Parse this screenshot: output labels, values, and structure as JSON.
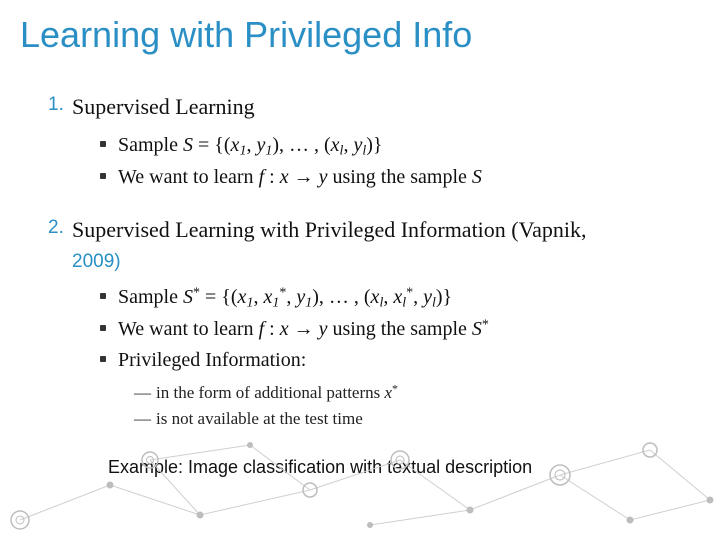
{
  "title": "Learning with Privileged Info",
  "sections": [
    {
      "num": "1.",
      "heading": "Supervised Learning",
      "bullets": [
        {
          "html": "Sample <span class='mi'>S</span> = {(<span class='mi'>x</span><span class='sub'>1</span>, <span class='mi'>y</span><span class='sub'>1</span>), … , (<span class='mi'>x</span><span class='sub'>l</span>, <span class='mi'>y</span><span class='sub'>l</span>)}"
        },
        {
          "html": "We want to learn <span class='mi'>f</span> : <span class='mi'>x</span> → <span class='mi'>y</span> using the sample <span class='mi'>S</span>"
        }
      ]
    },
    {
      "num": "2.",
      "heading": "Supervised Learning with Privileged Information (Vapnik,",
      "year": "2009)",
      "bullets": [
        {
          "html": "Sample <span class='mi'>S</span><span class='sup'>*</span> = {(<span class='mi'>x</span><span class='sub'>1</span>, <span class='mi'>x</span><span class='sub'>1</span><span class='sup'>*</span>, <span class='mi'>y</span><span class='sub'>1</span>), … , (<span class='mi'>x</span><span class='sub'>l</span>, <span class='mi'>x</span><span class='sub'>l</span><span class='sup'>*</span>, <span class='mi'>y</span><span class='sub'>l</span>)}"
        },
        {
          "html": "We want to learn <span class='mi'>f</span> : <span class='mi'>x</span> → <span class='mi'>y</span> using the sample <span class='mi'>S</span><span class='sup'>*</span>"
        },
        {
          "html": "Privileged Information:"
        }
      ],
      "sub": [
        {
          "html": "in the form of additional patterns <span class='mi'>x</span><span class='sup'>*</span>"
        },
        {
          "html": "is not available at the test time"
        }
      ]
    }
  ],
  "example": "Example: Image classification with textual description"
}
